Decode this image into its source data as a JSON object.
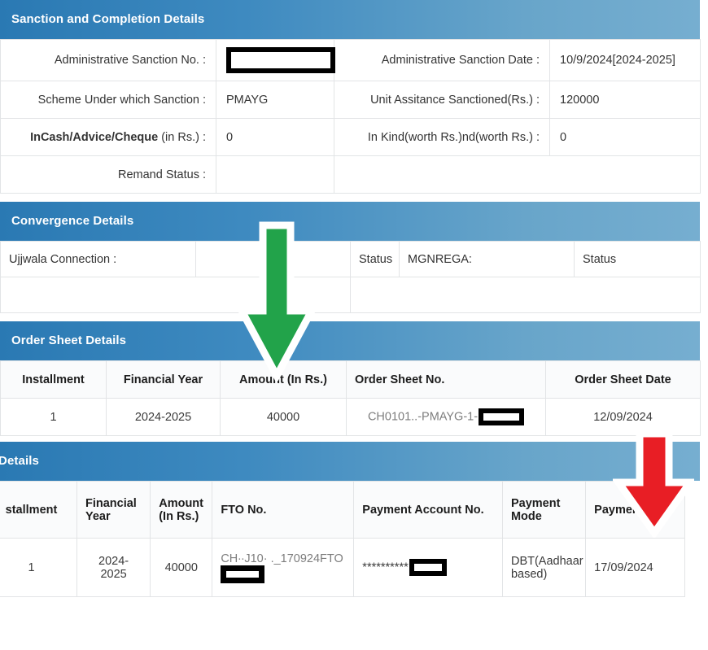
{
  "sanction": {
    "header": "Sanction and Completion Details",
    "rows": [
      {
        "label1": "Administrative Sanction No. :",
        "value1": "",
        "value1_redacted": true,
        "label2": "Administrative Sanction Date :",
        "value2": "10/9/2024[2024-2025]"
      },
      {
        "label1": "Scheme Under which Sanction :",
        "value1": "PMAYG",
        "label2": "Unit Assitance Sanctioned(Rs.) :",
        "value2": "120000"
      },
      {
        "label1_bold": "InCash/Advice/Cheque",
        "label1_plain": "(in Rs.) :",
        "value1": "0",
        "label2": "In Kind(worth Rs.)nd(worth Rs.) :",
        "value2": "0"
      },
      {
        "label1": "Remand Status :",
        "value1": "",
        "label2": "",
        "value2": ""
      }
    ]
  },
  "convergence": {
    "header": "Convergence Details",
    "row1": {
      "ujjwala_label": "Ujjwala Connection :",
      "ujjwala_value": "",
      "status1_label": "Status",
      "mgnrega_label": "MGNREGA:",
      "status2_label": "Status"
    },
    "row2": {
      "cell1": "",
      "cell2": ""
    }
  },
  "order_sheet": {
    "header": "Order Sheet Details",
    "columns": [
      "Installment",
      "Financial Year",
      "Amount (In Rs.)",
      "Order Sheet No.",
      "Order Sheet Date"
    ],
    "rows": [
      {
        "installment": "1",
        "financial_year": "2024-2025",
        "amount": "40000",
        "order_sheet_no": "CH0101..-PMAYG-1-",
        "order_sheet_no_redacted": true,
        "order_sheet_date": "12/09/2024"
      }
    ]
  },
  "fto": {
    "header": "O Details",
    "columns": [
      "stallment",
      "Financial Year",
      "Amount (In Rs.)",
      "FTO No.",
      "Payment Account No.",
      "Payment Mode",
      "Payment Date"
    ],
    "rows": [
      {
        "installment": "1",
        "financial_year": "2024-2025",
        "amount": "40000",
        "fto_no": "CH∙∙J10· ._170924FTO",
        "fto_no_redacted": true,
        "payment_account_no": "**********",
        "payment_account_no_redacted": true,
        "payment_mode": "DBT(Aadhaar based)",
        "payment_date": "17/09/2024"
      }
    ]
  },
  "annotations": {
    "green_arrow": {
      "name": "green-down-arrow",
      "color": "#22a34a",
      "outline": "#ffffff",
      "points_at": "Amount (In Rs.)"
    },
    "red_arrow": {
      "name": "red-down-arrow",
      "color": "#e81e25",
      "outline": "#ffffff",
      "points_at": "Payment Date"
    }
  },
  "colors": {
    "header_gradient_start": "#2a79b3",
    "header_gradient_end": "#76aed0",
    "header_text": "#ffffff",
    "border": "#e2e4e6",
    "table_header_bg": "#fafbfc"
  }
}
